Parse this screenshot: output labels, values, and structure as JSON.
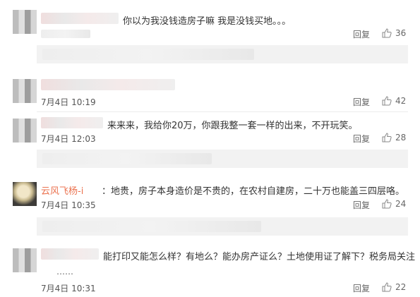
{
  "comments": [
    {
      "text": "你以为我没钱造房子嘛 我是没钱买地。。。",
      "reply_label": "回复",
      "likes": "36"
    },
    {
      "time": "7月4日 10:19",
      "reply_label": "回复",
      "likes": "42"
    },
    {
      "text": "来来来，我给你20万，你跟我整一套一样的出来，不开玩笑。",
      "time": "7月4日 12:03",
      "reply_label": "回复",
      "likes": "28"
    },
    {
      "username": "云风飞杨-i",
      "text": "：地贵，房子本身造价是不贵的，在农村自建房，二十万也能盖三四层咯。",
      "time": "7月4日 10:35",
      "reply_label": "回复",
      "likes": "24"
    },
    {
      "text": "能打印又能怎么样？有地么？能办房产证么？土地使用证了解下？税务局关注",
      "ellipsis": "……",
      "time": "7月4日 10:31",
      "reply_label": "回复",
      "likes": "22"
    }
  ],
  "icons": {
    "like": "thumbs-up-icon"
  },
  "colors": {
    "username": "#eb7350",
    "background": "#ffffff",
    "sub_bar": "#f2f2f2"
  }
}
